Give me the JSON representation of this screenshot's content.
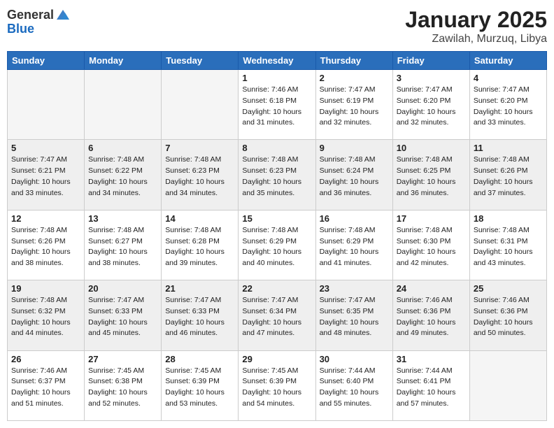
{
  "logo": {
    "general": "General",
    "blue": "Blue"
  },
  "header": {
    "month": "January 2025",
    "location": "Zawilah, Murzuq, Libya"
  },
  "days_of_week": [
    "Sunday",
    "Monday",
    "Tuesday",
    "Wednesday",
    "Thursday",
    "Friday",
    "Saturday"
  ],
  "weeks": [
    [
      {
        "day": "",
        "info": ""
      },
      {
        "day": "",
        "info": ""
      },
      {
        "day": "",
        "info": ""
      },
      {
        "day": "1",
        "info": "Sunrise: 7:46 AM\nSunset: 6:18 PM\nDaylight: 10 hours\nand 31 minutes."
      },
      {
        "day": "2",
        "info": "Sunrise: 7:47 AM\nSunset: 6:19 PM\nDaylight: 10 hours\nand 32 minutes."
      },
      {
        "day": "3",
        "info": "Sunrise: 7:47 AM\nSunset: 6:20 PM\nDaylight: 10 hours\nand 32 minutes."
      },
      {
        "day": "4",
        "info": "Sunrise: 7:47 AM\nSunset: 6:20 PM\nDaylight: 10 hours\nand 33 minutes."
      }
    ],
    [
      {
        "day": "5",
        "info": "Sunrise: 7:47 AM\nSunset: 6:21 PM\nDaylight: 10 hours\nand 33 minutes."
      },
      {
        "day": "6",
        "info": "Sunrise: 7:48 AM\nSunset: 6:22 PM\nDaylight: 10 hours\nand 34 minutes."
      },
      {
        "day": "7",
        "info": "Sunrise: 7:48 AM\nSunset: 6:23 PM\nDaylight: 10 hours\nand 34 minutes."
      },
      {
        "day": "8",
        "info": "Sunrise: 7:48 AM\nSunset: 6:23 PM\nDaylight: 10 hours\nand 35 minutes."
      },
      {
        "day": "9",
        "info": "Sunrise: 7:48 AM\nSunset: 6:24 PM\nDaylight: 10 hours\nand 36 minutes."
      },
      {
        "day": "10",
        "info": "Sunrise: 7:48 AM\nSunset: 6:25 PM\nDaylight: 10 hours\nand 36 minutes."
      },
      {
        "day": "11",
        "info": "Sunrise: 7:48 AM\nSunset: 6:26 PM\nDaylight: 10 hours\nand 37 minutes."
      }
    ],
    [
      {
        "day": "12",
        "info": "Sunrise: 7:48 AM\nSunset: 6:26 PM\nDaylight: 10 hours\nand 38 minutes."
      },
      {
        "day": "13",
        "info": "Sunrise: 7:48 AM\nSunset: 6:27 PM\nDaylight: 10 hours\nand 38 minutes."
      },
      {
        "day": "14",
        "info": "Sunrise: 7:48 AM\nSunset: 6:28 PM\nDaylight: 10 hours\nand 39 minutes."
      },
      {
        "day": "15",
        "info": "Sunrise: 7:48 AM\nSunset: 6:29 PM\nDaylight: 10 hours\nand 40 minutes."
      },
      {
        "day": "16",
        "info": "Sunrise: 7:48 AM\nSunset: 6:29 PM\nDaylight: 10 hours\nand 41 minutes."
      },
      {
        "day": "17",
        "info": "Sunrise: 7:48 AM\nSunset: 6:30 PM\nDaylight: 10 hours\nand 42 minutes."
      },
      {
        "day": "18",
        "info": "Sunrise: 7:48 AM\nSunset: 6:31 PM\nDaylight: 10 hours\nand 43 minutes."
      }
    ],
    [
      {
        "day": "19",
        "info": "Sunrise: 7:48 AM\nSunset: 6:32 PM\nDaylight: 10 hours\nand 44 minutes."
      },
      {
        "day": "20",
        "info": "Sunrise: 7:47 AM\nSunset: 6:33 PM\nDaylight: 10 hours\nand 45 minutes."
      },
      {
        "day": "21",
        "info": "Sunrise: 7:47 AM\nSunset: 6:33 PM\nDaylight: 10 hours\nand 46 minutes."
      },
      {
        "day": "22",
        "info": "Sunrise: 7:47 AM\nSunset: 6:34 PM\nDaylight: 10 hours\nand 47 minutes."
      },
      {
        "day": "23",
        "info": "Sunrise: 7:47 AM\nSunset: 6:35 PM\nDaylight: 10 hours\nand 48 minutes."
      },
      {
        "day": "24",
        "info": "Sunrise: 7:46 AM\nSunset: 6:36 PM\nDaylight: 10 hours\nand 49 minutes."
      },
      {
        "day": "25",
        "info": "Sunrise: 7:46 AM\nSunset: 6:36 PM\nDaylight: 10 hours\nand 50 minutes."
      }
    ],
    [
      {
        "day": "26",
        "info": "Sunrise: 7:46 AM\nSunset: 6:37 PM\nDaylight: 10 hours\nand 51 minutes."
      },
      {
        "day": "27",
        "info": "Sunrise: 7:45 AM\nSunset: 6:38 PM\nDaylight: 10 hours\nand 52 minutes."
      },
      {
        "day": "28",
        "info": "Sunrise: 7:45 AM\nSunset: 6:39 PM\nDaylight: 10 hours\nand 53 minutes."
      },
      {
        "day": "29",
        "info": "Sunrise: 7:45 AM\nSunset: 6:39 PM\nDaylight: 10 hours\nand 54 minutes."
      },
      {
        "day": "30",
        "info": "Sunrise: 7:44 AM\nSunset: 6:40 PM\nDaylight: 10 hours\nand 55 minutes."
      },
      {
        "day": "31",
        "info": "Sunrise: 7:44 AM\nSunset: 6:41 PM\nDaylight: 10 hours\nand 57 minutes."
      },
      {
        "day": "",
        "info": ""
      }
    ]
  ]
}
